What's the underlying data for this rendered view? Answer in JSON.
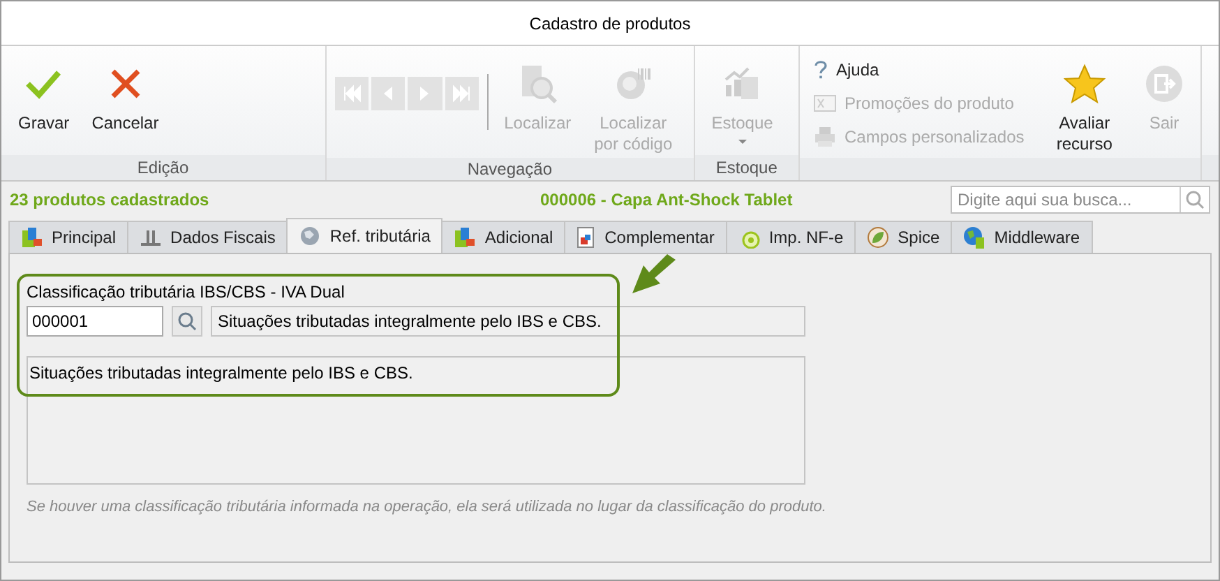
{
  "window": {
    "title": "Cadastro de produtos"
  },
  "ribbon": {
    "groups": [
      {
        "label": "Edição",
        "items": [
          {
            "kind": "large",
            "label": "Gravar",
            "disabled": false
          },
          {
            "kind": "large",
            "label": "Cancelar",
            "disabled": false
          }
        ]
      },
      {
        "label": "Navegação",
        "items": [
          {
            "kind": "nav",
            "disabled": true
          },
          {
            "kind": "nav",
            "disabled": true
          },
          {
            "kind": "nav",
            "disabled": true
          },
          {
            "kind": "nav",
            "disabled": true
          },
          {
            "kind": "large",
            "label": "Localizar",
            "disabled": true
          },
          {
            "kind": "large",
            "label": "Localizar por código",
            "disabled": true
          }
        ]
      },
      {
        "label": "Estoque",
        "items": [
          {
            "kind": "dropdown",
            "label": "Estoque",
            "disabled": true
          }
        ]
      },
      {
        "items": [
          {
            "kind": "small",
            "label": "Ajuda",
            "disabled": false
          },
          {
            "kind": "small",
            "label": "Promoções do produto",
            "disabled": true
          },
          {
            "kind": "small",
            "label": "Campos personalizados",
            "disabled": true
          },
          {
            "kind": "large",
            "label": "Avaliar recurso",
            "disabled": false
          },
          {
            "kind": "large",
            "label": "Sair",
            "disabled": true
          }
        ]
      }
    ]
  },
  "info": {
    "count": "23 produtos cadastrados",
    "product": "000006 - Capa Ant-Shock Tablet",
    "search": {
      "placeholder": "Digite aqui sua busca..."
    }
  },
  "tabs": [
    {
      "label": "Principal",
      "selected": false
    },
    {
      "label": "Dados Fiscais",
      "selected": false
    },
    {
      "label": "Ref. tributária",
      "selected": true
    },
    {
      "label": "Adicional",
      "selected": false
    },
    {
      "label": "Complementar",
      "selected": false
    },
    {
      "label": "Imp. NF-e",
      "selected": false
    },
    {
      "label": "Spice",
      "selected": false
    },
    {
      "label": "Middleware",
      "selected": false
    }
  ],
  "form": {
    "label": "Classificação tributária IBS/CBS - IVA Dual",
    "code": "000001",
    "description": "Situações tributadas integralmente pelo IBS e CBS.",
    "details": "Situações tributadas integralmente pelo IBS e CBS.",
    "note": "Se houver uma classificação tributária informada na operação, ela será utilizada no lugar da classificação do produto."
  }
}
